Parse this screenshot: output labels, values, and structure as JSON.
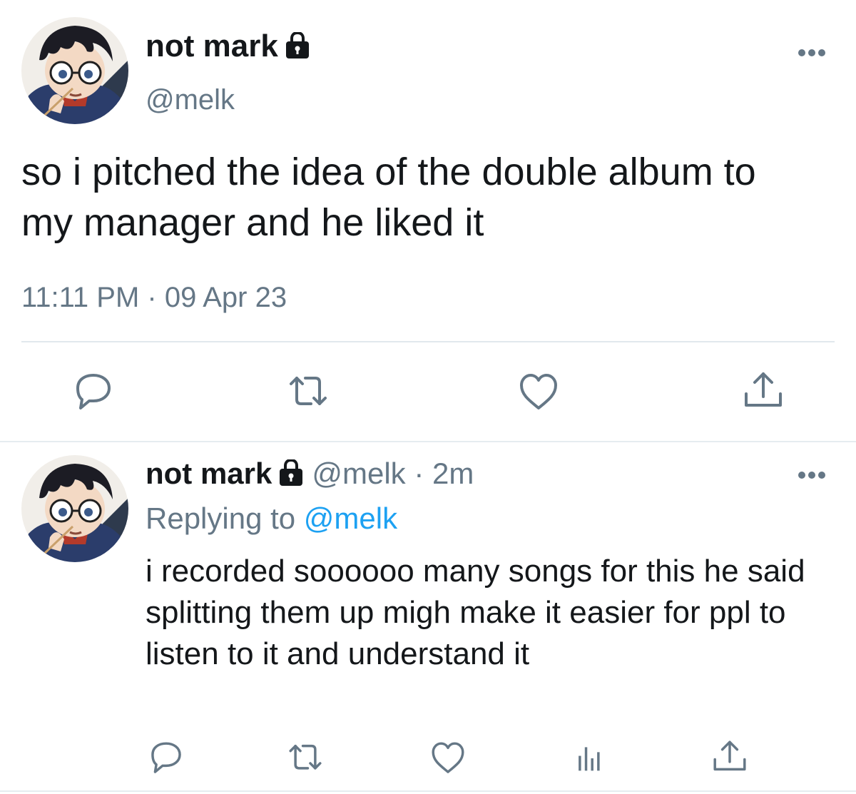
{
  "main_tweet": {
    "display_name": "not mark",
    "handle": "@melk",
    "text": "so i pitched the idea of the double album to my manager and he liked it",
    "timestamp": "11:11 PM · 09 Apr 23",
    "icons": [
      "avatar",
      "lock-icon",
      "more-icon",
      "reply-icon",
      "retweet-icon",
      "like-icon",
      "share-icon"
    ]
  },
  "reply_tweet": {
    "display_name": "not mark",
    "handle_time": "@melk · 2m",
    "replying_prefix": "Replying to",
    "replying_mention": "@melk",
    "text": "i recorded soooooo many songs for this he said splitting them up migh make it easier for ppl to listen to it and understand it",
    "icons": [
      "avatar",
      "lock-icon",
      "more-icon",
      "reply-icon",
      "retweet-icon",
      "like-icon",
      "analytics-icon",
      "share-icon"
    ]
  },
  "colors": {
    "text": "#14171a",
    "secondary": "#657786",
    "link": "#1da1f2",
    "divider": "#e1e8ed"
  }
}
